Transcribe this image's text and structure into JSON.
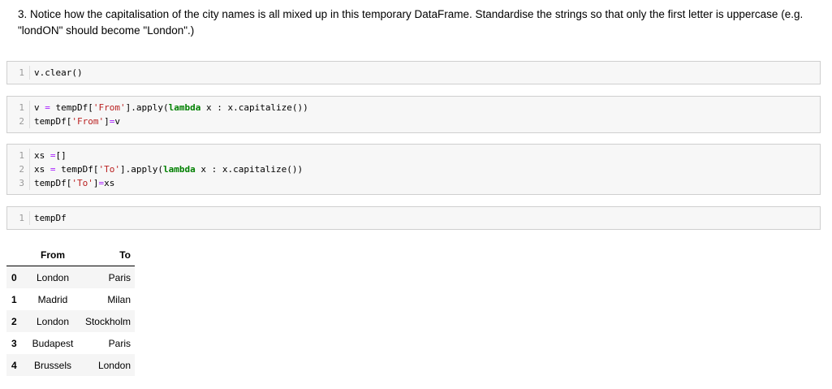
{
  "markdown": {
    "text": "3. Notice how the capitalisation of the city names is all mixed up in this temporary DataFrame. Standardise the strings so that only the first letter is uppercase (e.g. \"londON\" should become \"London\".)"
  },
  "cells": [
    {
      "line_numbers": [
        "1"
      ],
      "lines": [
        [
          {
            "t": "v.clear()",
            "c": ""
          }
        ]
      ]
    },
    {
      "line_numbers": [
        "1",
        "2"
      ],
      "lines": [
        [
          {
            "t": "v ",
            "c": ""
          },
          {
            "t": "=",
            "c": "op"
          },
          {
            "t": " tempDf[",
            "c": ""
          },
          {
            "t": "'From'",
            "c": "str"
          },
          {
            "t": "].apply(",
            "c": ""
          },
          {
            "t": "lambda",
            "c": "kw"
          },
          {
            "t": " x : x.capitalize())",
            "c": ""
          }
        ],
        [
          {
            "t": "tempDf[",
            "c": ""
          },
          {
            "t": "'From'",
            "c": "str"
          },
          {
            "t": "]",
            "c": ""
          },
          {
            "t": "=",
            "c": "op"
          },
          {
            "t": "v",
            "c": ""
          }
        ]
      ]
    },
    {
      "line_numbers": [
        "1",
        "2",
        "3"
      ],
      "lines": [
        [
          {
            "t": "xs ",
            "c": ""
          },
          {
            "t": "=",
            "c": "op"
          },
          {
            "t": "[]",
            "c": ""
          }
        ],
        [
          {
            "t": "xs ",
            "c": ""
          },
          {
            "t": "=",
            "c": "op"
          },
          {
            "t": " tempDf[",
            "c": ""
          },
          {
            "t": "'To'",
            "c": "str"
          },
          {
            "t": "].apply(",
            "c": ""
          },
          {
            "t": "lambda",
            "c": "kw"
          },
          {
            "t": " x : x.capitalize())",
            "c": ""
          }
        ],
        [
          {
            "t": "tempDf[",
            "c": ""
          },
          {
            "t": "'To'",
            "c": "str"
          },
          {
            "t": "]",
            "c": ""
          },
          {
            "t": "=",
            "c": "op"
          },
          {
            "t": "xs",
            "c": ""
          }
        ]
      ]
    },
    {
      "line_numbers": [
        "1"
      ],
      "lines": [
        [
          {
            "t": "tempDf",
            "c": ""
          }
        ]
      ]
    }
  ],
  "dataframe": {
    "columns": [
      "",
      "From",
      "To"
    ],
    "rows": [
      {
        "index": "0",
        "From": "London",
        "To": "Paris"
      },
      {
        "index": "1",
        "From": "Madrid",
        "To": "Milan"
      },
      {
        "index": "2",
        "From": "London",
        "To": "Stockholm"
      },
      {
        "index": "3",
        "From": "Budapest",
        "To": "Paris"
      },
      {
        "index": "4",
        "From": "Brussels",
        "To": "London"
      }
    ]
  }
}
